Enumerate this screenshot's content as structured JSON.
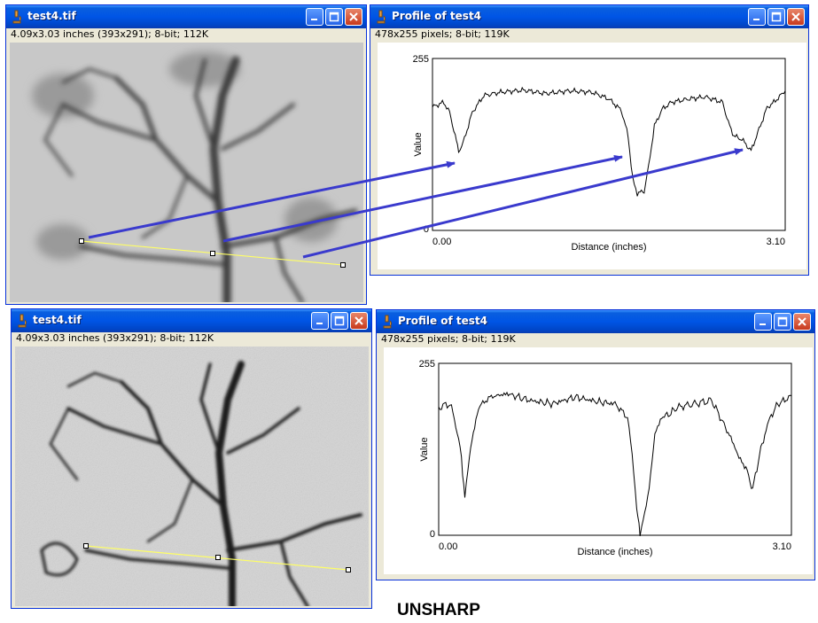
{
  "windows": {
    "image_top": {
      "title": "test4.tif",
      "info": "4.09x3.03 inches (393x291); 8-bit; 112K"
    },
    "profile_top": {
      "title": "Profile of test4",
      "info": "478x255 pixels; 8-bit; 119K"
    },
    "image_bottom": {
      "title": "test4.tif",
      "info": "4.09x3.03 inches (393x291); 8-bit; 112K"
    },
    "profile_bottom": {
      "title": "Profile of test4",
      "info": "478x255 pixels; 8-bit; 119K"
    }
  },
  "caption": "UNSHARP",
  "colors": {
    "titlebar": "#0055e5",
    "window_bg": "#ece9d8",
    "selection_line": "#ffff66",
    "arrow": "#3a3acd"
  },
  "icons": {
    "app": "microscope-icon",
    "minimize": "minimize-icon",
    "maximize": "maximize-icon",
    "close": "close-icon"
  },
  "chart_data": [
    {
      "type": "line",
      "title": "",
      "xlabel": "Distance (inches)",
      "ylabel": "Value",
      "xlim": [
        0,
        3.1
      ],
      "ylim": [
        0,
        255
      ],
      "x_tick_labels": [
        "0.00",
        "3.10"
      ],
      "y_tick_labels": [
        "0",
        "255"
      ],
      "grid": false,
      "series": [
        {
          "x": [
            0.0,
            0.1,
            0.15,
            0.2,
            0.23,
            0.27,
            0.35,
            0.45,
            0.6,
            0.8,
            1.0,
            1.2,
            1.4,
            1.55,
            1.66,
            1.72,
            1.76,
            1.8,
            1.86,
            1.9,
            1.95,
            2.02,
            2.1,
            2.25,
            2.4,
            2.55,
            2.6,
            2.65,
            2.72,
            2.8,
            2.87,
            2.94,
            3.0,
            3.1
          ],
          "y": [
            183,
            190,
            175,
            140,
            117,
            130,
            175,
            200,
            205,
            208,
            203,
            207,
            205,
            195,
            178,
            140,
            75,
            55,
            58,
            95,
            155,
            180,
            190,
            195,
            198,
            190,
            160,
            140,
            135,
            118,
            150,
            182,
            190,
            207
          ]
        }
      ]
    },
    {
      "type": "line",
      "title": "",
      "xlabel": "Distance (inches)",
      "ylabel": "Value",
      "xlim": [
        0,
        3.1
      ],
      "ylim": [
        0,
        255
      ],
      "x_tick_labels": [
        "0.00",
        "3.10"
      ],
      "y_tick_labels": [
        "0",
        "255"
      ],
      "grid": false,
      "series": [
        {
          "x": [
            0.0,
            0.1,
            0.15,
            0.2,
            0.23,
            0.27,
            0.35,
            0.45,
            0.6,
            0.8,
            1.0,
            1.2,
            1.4,
            1.55,
            1.66,
            1.7,
            1.74,
            1.77,
            1.81,
            1.85,
            1.9,
            1.96,
            2.03,
            2.1,
            2.25,
            2.4,
            2.52,
            2.58,
            2.64,
            2.7,
            2.76,
            2.82,
            2.9,
            2.98,
            3.04,
            3.1
          ],
          "y": [
            190,
            195,
            165,
            115,
            55,
            120,
            190,
            205,
            210,
            200,
            195,
            205,
            198,
            195,
            175,
            120,
            40,
            5,
            30,
            70,
            150,
            175,
            180,
            190,
            195,
            200,
            160,
            140,
            115,
            100,
            68,
            120,
            170,
            195,
            200,
            207
          ]
        }
      ]
    }
  ]
}
